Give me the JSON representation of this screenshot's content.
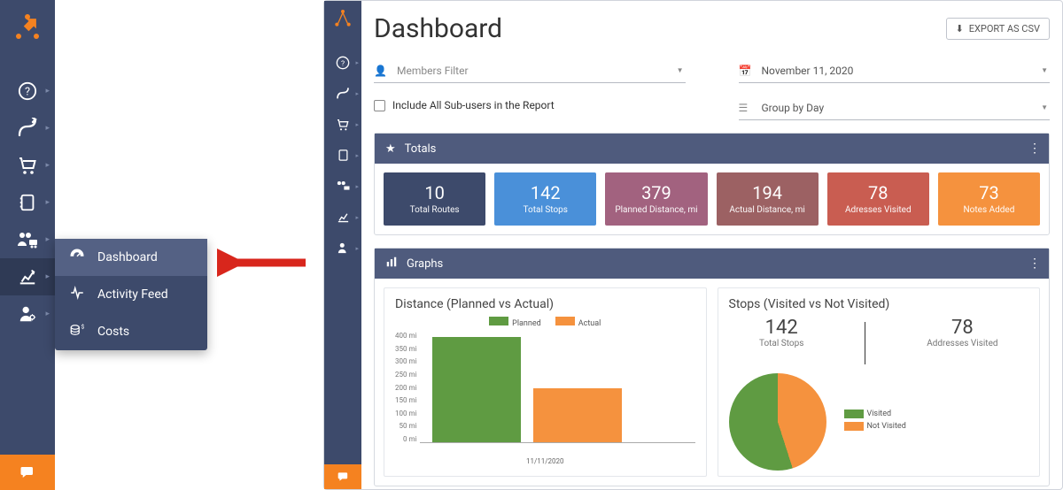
{
  "sidebar": {
    "items": [
      "help",
      "routes",
      "orders",
      "addressbook",
      "team",
      "analytics",
      "users"
    ],
    "submenu": [
      {
        "icon": "gauge",
        "label": "Dashboard"
      },
      {
        "icon": "activity",
        "label": "Activity Feed"
      },
      {
        "icon": "coins",
        "label": "Costs"
      }
    ]
  },
  "header": {
    "title": "Dashboard",
    "export_label": "EXPORT AS CSV"
  },
  "filters": {
    "members_placeholder": "Members Filter",
    "include_subusers": "Include All Sub-users in the Report",
    "date_value": "November 11, 2020",
    "group_value": "Group by Day"
  },
  "totals": {
    "heading": "Totals",
    "cards": [
      {
        "value": "10",
        "label": "Total Routes",
        "color": "#3d4a6b"
      },
      {
        "value": "142",
        "label": "Total Stops",
        "color": "#4a90d9"
      },
      {
        "value": "379",
        "label": "Planned Distance, mi",
        "color": "#a2627f"
      },
      {
        "value": "194",
        "label": "Actual Distance, mi",
        "color": "#9c6163"
      },
      {
        "value": "78",
        "label": "Adresses Visited",
        "color": "#c95d51"
      },
      {
        "value": "73",
        "label": "Notes Added",
        "color": "#f5923e"
      }
    ]
  },
  "graphs": {
    "heading": "Graphs",
    "distance": {
      "title": "Distance (Planned vs Actual)",
      "legend": [
        "Planned",
        "Actual"
      ],
      "xlabel": "11/11/2020"
    },
    "stops": {
      "title": "Stops (Visited vs Not Visited)",
      "total_value": "142",
      "total_label": "Total Stops",
      "visited_value": "78",
      "visited_label": "Addresses Visited",
      "legend": [
        "Visited",
        "Not Visited"
      ]
    }
  },
  "chart_data": [
    {
      "type": "bar",
      "title": "Distance (Planned vs Actual)",
      "categories": [
        "11/11/2020"
      ],
      "series": [
        {
          "name": "Planned",
          "values": [
            379
          ],
          "color": "#5f9b42"
        },
        {
          "name": "Actual",
          "values": [
            194
          ],
          "color": "#f5923e"
        }
      ],
      "ylabel": "mi",
      "ylim": [
        0,
        400
      ],
      "yticks": [
        0,
        50,
        100,
        150,
        200,
        250,
        300,
        350,
        400
      ]
    },
    {
      "type": "pie",
      "title": "Stops (Visited vs Not Visited)",
      "series": [
        {
          "name": "Visited",
          "value": 78,
          "color": "#5f9b42"
        },
        {
          "name": "Not Visited",
          "value": 64,
          "color": "#f5923e"
        }
      ],
      "total": 142
    }
  ]
}
